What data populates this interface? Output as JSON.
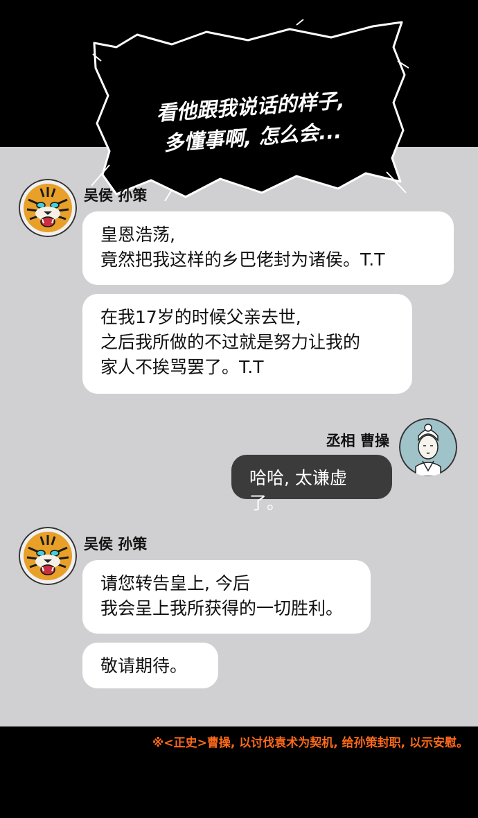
{
  "narration": {
    "text": "看他跟我说话的样子,\n多懂事啊, 怎么会..."
  },
  "messages": [
    {
      "speaker": "吴侯 孙策",
      "avatar_icon": "tiger-icon",
      "bubbles": [
        "皇恩浩荡,\n竟然把我这样的乡巴佬封为诸侯。T.T",
        "在我17岁的时候父亲去世,\n之后我所做的不过就是努力让我的\n家人不挨骂罢了。T.T"
      ]
    },
    {
      "speaker": "丞相 曹操",
      "avatar_icon": "official-portrait-icon",
      "bubbles": [
        "哈哈, 太谦虚了。"
      ]
    },
    {
      "speaker": "吴侯 孙策",
      "avatar_icon": "tiger-icon",
      "bubbles": [
        "请您转告皇上, 今后\n我会呈上我所获得的一切胜利。",
        "敬请期待。"
      ]
    }
  ],
  "footnote": "※<正史>曹操, 以讨伐袁术为契机, 给孙策封职, 以示安慰。",
  "colors": {
    "panel": "#d0d0d2",
    "dark_bubble": "#3b3b3b",
    "footnote": "#ff6a1a"
  }
}
